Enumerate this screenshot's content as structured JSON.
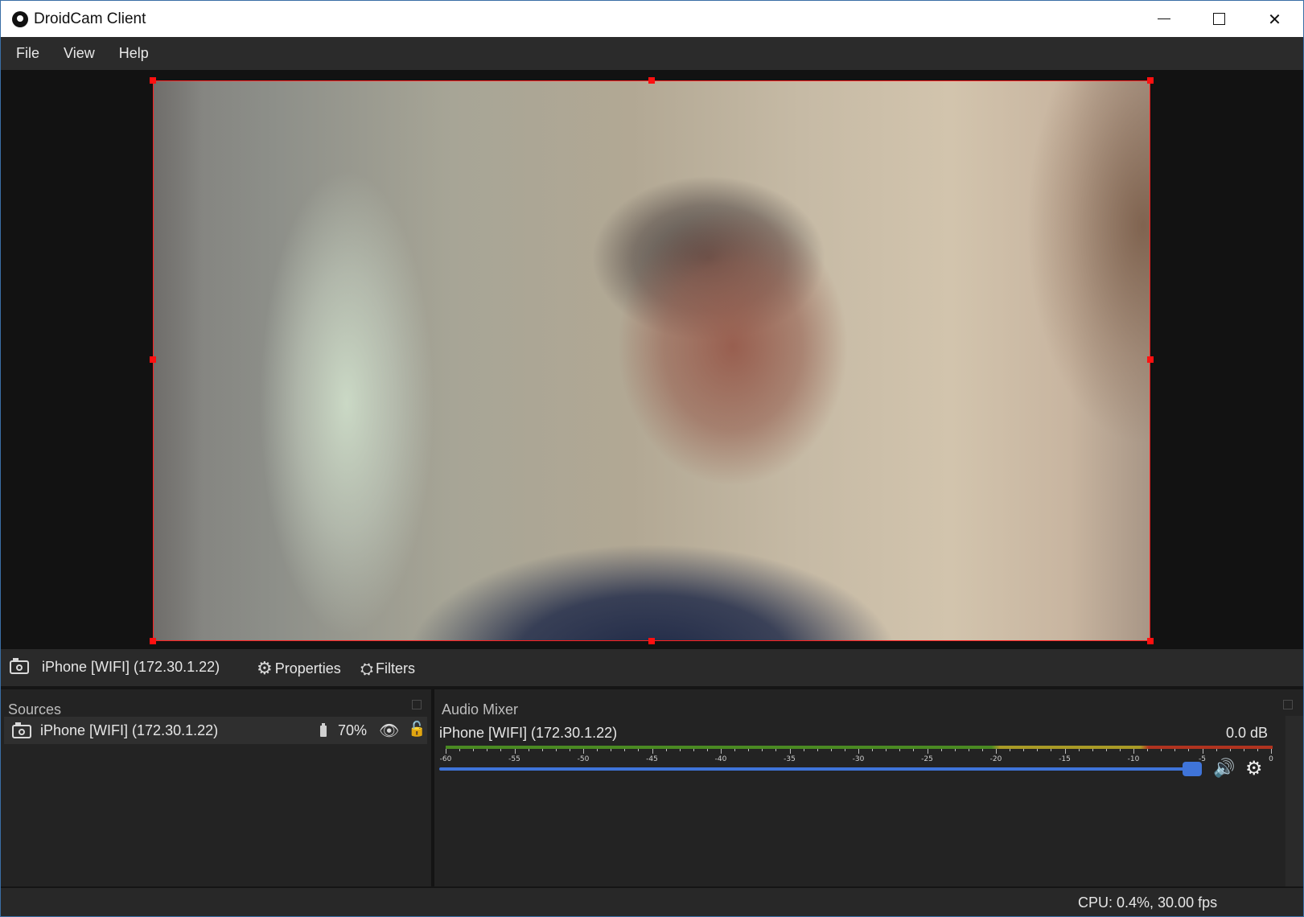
{
  "window": {
    "title": "DroidCam Client",
    "controls": {
      "minimize": "minimize",
      "maximize": "maximize",
      "close": "close"
    }
  },
  "menubar": {
    "items": [
      {
        "label": "File"
      },
      {
        "label": "View"
      },
      {
        "label": "Help"
      }
    ]
  },
  "preview": {
    "icon": "video-preview",
    "selection_color": "#ff2020"
  },
  "source_toolbar": {
    "source_name": "iPhone [WIFI] (172.30.1.22)",
    "properties_label": "Properties",
    "filters_label": "Filters"
  },
  "sources_dock": {
    "title": "Sources",
    "items": [
      {
        "name": "iPhone [WIFI] (172.30.1.22)",
        "battery": "70%",
        "icons": [
          "camera-icon",
          "battery-icon",
          "eye-icon",
          "lock-icon"
        ]
      }
    ]
  },
  "audio_mixer": {
    "title": "Audio Mixer",
    "channel_name": "iPhone [WIFI] (172.30.1.22)",
    "level": "0.0 dB",
    "scale_labels": [
      "-60",
      "-55",
      "-50",
      "-45",
      "-40",
      "-35",
      "-30",
      "-25",
      "-20",
      "-15",
      "-10",
      "-5",
      "0"
    ],
    "volume_fraction": 1.0,
    "accent_color": "#3f74d9"
  },
  "statusbar": {
    "text": "CPU: 0.4%, 30.00 fps"
  }
}
